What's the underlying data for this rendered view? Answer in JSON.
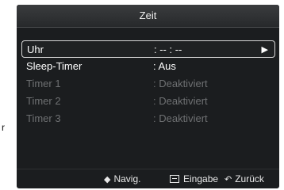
{
  "window": {
    "title": "Zeit"
  },
  "stray_text": "r",
  "menu": {
    "items": [
      {
        "label": "Uhr",
        "value": ": -- : --",
        "arrow": "▶"
      },
      {
        "label": "Sleep-Timer",
        "value": ": Aus"
      },
      {
        "label": "Timer 1",
        "value": ": Deaktiviert"
      },
      {
        "label": "Timer 2",
        "value": ": Deaktiviert"
      },
      {
        "label": "Timer 3",
        "value": ": Deaktiviert"
      }
    ]
  },
  "footer": {
    "nav": {
      "icon": "◆",
      "label": "Navig."
    },
    "enter": {
      "label": "Eingabe"
    },
    "back": {
      "icon": "↶",
      "label": "Zurück"
    }
  },
  "colors": {
    "panel": "#1b1d1f",
    "disabled_text": "#6e7072",
    "selection_border": "#d8d8d8"
  },
  "icons": {
    "nav": "updown-arrows-icon",
    "enter": "enter-icon",
    "back": "return-icon",
    "submenu": "right-triangle-icon"
  }
}
